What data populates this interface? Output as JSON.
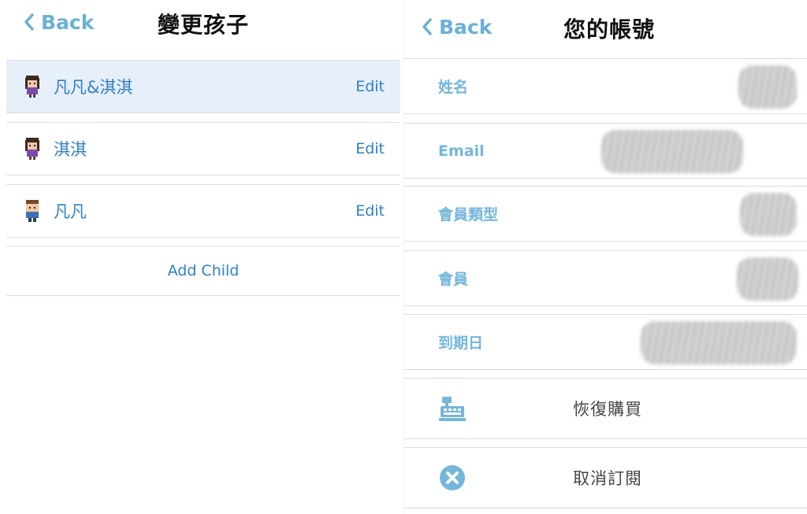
{
  "left_panel": {
    "back_label": "Back",
    "title": "變更孩子",
    "children": [
      {
        "name": "凡凡&淇淇",
        "edit": "Edit",
        "selected": true
      },
      {
        "name": "淇淇",
        "edit": "Edit",
        "selected": false
      },
      {
        "name": "凡凡",
        "edit": "Edit",
        "selected": false
      }
    ],
    "add_child": "Add Child"
  },
  "right_panel": {
    "back_label": "Back",
    "title": "您的帳號",
    "fields": [
      {
        "label": "姓名"
      },
      {
        "label": "Email"
      },
      {
        "label": "會員類型"
      },
      {
        "label": "會員"
      },
      {
        "label": "到期日"
      }
    ],
    "actions": [
      {
        "label": "恢復購買",
        "icon": "cash-register-icon"
      },
      {
        "label": "取消訂閱",
        "icon": "cancel-circle-icon"
      }
    ]
  },
  "colors": {
    "accent_blue": "#2e7fca",
    "label_blue": "#74b6dc",
    "back_blue": "#6ab0d8",
    "selected_bg": "#e7effa"
  }
}
